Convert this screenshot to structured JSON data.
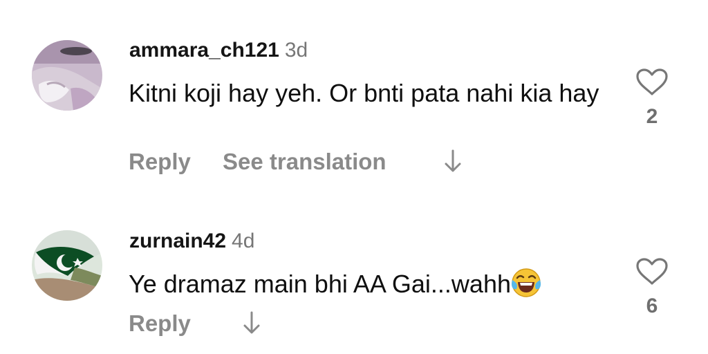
{
  "comments": [
    {
      "username": "ammara_ch121",
      "age": "3d",
      "text": "Kitni koji hay yeh. Or bnti pata nahi kia hay",
      "reply_label": "Reply",
      "translation_label": "See translation",
      "likes": "2",
      "avatar_icon": "profile-photo",
      "reply_arrow_icon": "arrow-down-icon",
      "like_icon": "heart-outline-icon"
    },
    {
      "username": "zurnain42",
      "age": "4d",
      "text": "Ye dramaz main bhi AA Gai...wahh",
      "emoji": "😂",
      "reply_label": "Reply",
      "likes": "6",
      "avatar_icon": "pakistan-flag-photo",
      "reply_arrow_icon": "arrow-down-icon",
      "like_icon": "heart-outline-icon"
    }
  ],
  "colors": {
    "username": "#151515",
    "comment_text": "#0f0f0f",
    "muted": "#767676",
    "action_text": "#8a8a8a",
    "background": "#ffffff"
  }
}
